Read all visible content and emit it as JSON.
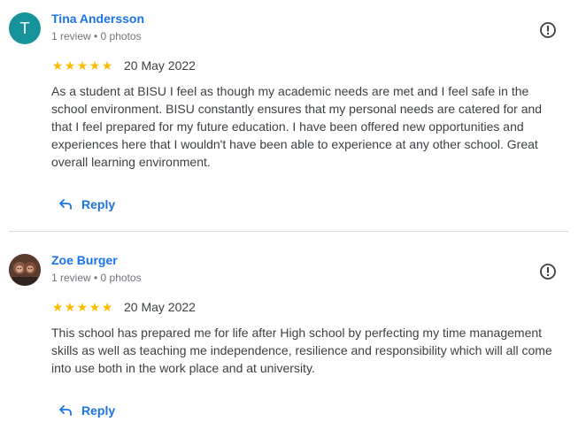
{
  "reviews": [
    {
      "avatar_letter": "T",
      "avatar_color": "#16929b",
      "name": "Tina Andersson",
      "meta": "1 review • 0 photos",
      "stars": 5,
      "star_glyph": "★",
      "date": "20 May 2022",
      "text": "As a student at BISU I feel as though my academic needs are met and I feel safe in the school environment. BISU constantly ensures that my personal needs are catered for and that I feel prepared for my future education. I have been offered new opportunities and experiences here that I wouldn't have been able to experience at any other school. Great overall learning environment.",
      "reply_label": "Reply"
    },
    {
      "avatar_letter": "",
      "name": "Zoe Burger",
      "meta": "1 review • 0 photos",
      "stars": 5,
      "star_glyph": "★",
      "date": "20 May 2022",
      "text": "This school has prepared me for life after High school by perfecting my time management skills as well as teaching me independence, resilience and responsibility which will all come into use both in the work place and at university.",
      "reply_label": "Reply"
    }
  ],
  "colors": {
    "accent": "#1a73e8",
    "star": "#fbbc04",
    "meta": "#70757a",
    "divider": "#dadce0"
  },
  "icons": {
    "report": "report-flag-icon",
    "reply": "reply-arrow-icon",
    "star": "star-icon"
  }
}
